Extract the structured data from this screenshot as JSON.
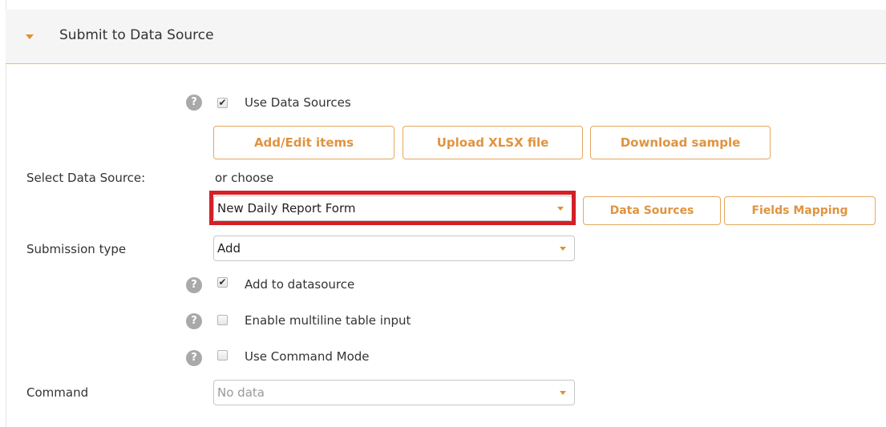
{
  "section": {
    "title": "Submit to Data Source"
  },
  "help_glyph": "?",
  "check_glyph": "✔",
  "options": {
    "use_data_sources": {
      "label": "Use Data Sources",
      "checked": true
    },
    "add_to_datasource": {
      "label": "Add to datasource",
      "checked": true
    },
    "enable_multiline": {
      "label": "Enable multiline table input",
      "checked": false
    },
    "use_command_mode": {
      "label": "Use Command Mode",
      "checked": false
    }
  },
  "buttons": {
    "add_edit": "Add/Edit items",
    "upload_xlsx": "Upload XLSX file",
    "download_sample": "Download sample",
    "data_sources": "Data Sources",
    "fields_mapping": "Fields Mapping"
  },
  "select_data_source": {
    "label": "Select Data Source:",
    "or_choose": "or choose",
    "value": "New Daily Report Form"
  },
  "submission_type": {
    "label": "Submission type",
    "value": "Add"
  },
  "command": {
    "label": "Command",
    "value": "No data"
  },
  "colors": {
    "accent": "#e09340",
    "highlight": "#d41f26",
    "header_border": "#f0c24b"
  }
}
